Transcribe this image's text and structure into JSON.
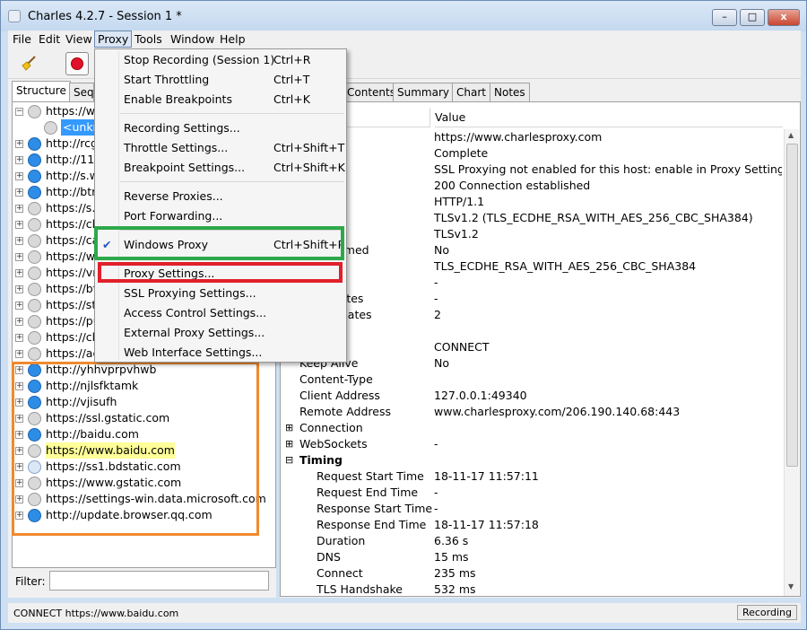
{
  "window": {
    "title": "Charles 4.2.7 - Session 1 *",
    "min": "–",
    "max": "□",
    "close": "x"
  },
  "menubar": [
    "File",
    "Edit",
    "View",
    "Proxy",
    "Tools",
    "Window",
    "Help"
  ],
  "left_tabs": [
    "Structure",
    "Sequ"
  ],
  "tree": [
    {
      "label": "https://w",
      "exp": "−",
      "icon": "lock",
      "sel": false,
      "hl": false
    },
    {
      "label": "<unkn",
      "exp": "",
      "icon": "lock",
      "sel": true,
      "hl": false
    },
    {
      "label": "http://rcg",
      "exp": "+",
      "icon": "globe",
      "sel": false,
      "hl": false
    },
    {
      "label": "http://112",
      "exp": "+",
      "icon": "globe",
      "sel": false,
      "hl": false
    },
    {
      "label": "http://s.w",
      "exp": "+",
      "icon": "globe",
      "sel": false,
      "hl": false
    },
    {
      "label": "http://btr",
      "exp": "+",
      "icon": "globe",
      "sel": false,
      "hl": false
    },
    {
      "label": "https://s.w",
      "exp": "+",
      "icon": "lock",
      "sel": false,
      "hl": false
    },
    {
      "label": "https://cli",
      "exp": "+",
      "icon": "lock",
      "sel": false,
      "hl": false
    },
    {
      "label": "https://ca",
      "exp": "+",
      "icon": "lock",
      "sel": false,
      "hl": false
    },
    {
      "label": "https://w",
      "exp": "+",
      "icon": "lock",
      "sel": false,
      "hl": false
    },
    {
      "label": "https://vn",
      "exp": "+",
      "icon": "lock",
      "sel": false,
      "hl": false
    },
    {
      "label": "https://bt",
      "exp": "+",
      "icon": "lock",
      "sel": false,
      "hl": false
    },
    {
      "label": "https://st",
      "exp": "+",
      "icon": "lock",
      "sel": false,
      "hl": false
    },
    {
      "label": "https://pu",
      "exp": "+",
      "icon": "lock",
      "sel": false,
      "hl": false
    },
    {
      "label": "https://cli",
      "exp": "+",
      "icon": "lock",
      "sel": false,
      "hl": false
    },
    {
      "label": "https://ac",
      "exp": "+",
      "icon": "lock",
      "sel": false,
      "hl": false
    },
    {
      "label": "http://yhhvprpvhwb",
      "exp": "+",
      "icon": "globe",
      "sel": false,
      "hl": false
    },
    {
      "label": "http://njlsfktamk",
      "exp": "+",
      "icon": "globe",
      "sel": false,
      "hl": false
    },
    {
      "label": "http://vjisufh",
      "exp": "+",
      "icon": "globe",
      "sel": false,
      "hl": false
    },
    {
      "label": "https://ssl.gstatic.com",
      "exp": "+",
      "icon": "lock",
      "sel": false,
      "hl": false
    },
    {
      "label": "http://baidu.com",
      "exp": "+",
      "icon": "globe",
      "sel": false,
      "hl": false
    },
    {
      "label": "https://www.baidu.com",
      "exp": "+",
      "icon": "lock",
      "sel": false,
      "hl": true
    },
    {
      "label": "https://ss1.bdstatic.com",
      "exp": "+",
      "icon": "spin",
      "sel": false,
      "hl": false
    },
    {
      "label": "https://www.gstatic.com",
      "exp": "+",
      "icon": "lock",
      "sel": false,
      "hl": false
    },
    {
      "label": "https://settings-win.data.microsoft.com",
      "exp": "+",
      "icon": "lock",
      "sel": false,
      "hl": false
    },
    {
      "label": "http://update.browser.qq.com",
      "exp": "+",
      "icon": "globe",
      "sel": false,
      "hl": false
    }
  ],
  "filter": {
    "label": "Filter:",
    "value": ""
  },
  "right_tabs": [
    "Contents",
    "Summary",
    "Chart",
    "Notes"
  ],
  "table_header": {
    "value": "Value"
  },
  "rows": [
    {
      "name": "",
      "value": "https://www.charlesproxy.com",
      "indent": 0,
      "exp": ""
    },
    {
      "name": "",
      "value": "Complete",
      "indent": 0,
      "exp": ""
    },
    {
      "name": "",
      "value": "SSL Proxying not enabled for this host: enable in Proxy Settings, ...",
      "indent": 0,
      "exp": ""
    },
    {
      "name": "e Code",
      "value": "200 Connection established",
      "indent": 0,
      "exp": ""
    },
    {
      "name": "",
      "value": "HTTP/1.1",
      "indent": 0,
      "exp": ""
    },
    {
      "name": "",
      "value": "TLSv1.2 (TLS_ECDHE_RSA_WITH_AES_256_CBC_SHA384)",
      "indent": 0,
      "exp": ""
    },
    {
      "name": "col",
      "value": "TLSv1.2",
      "indent": 0,
      "exp": ""
    },
    {
      "name": "on Resumed",
      "value": "No",
      "indent": 0,
      "exp": ""
    },
    {
      "name": "r Suite",
      "value": "TLS_ECDHE_RSA_WITH_AES_256_CBC_SHA384",
      "indent": 0,
      "exp": ""
    },
    {
      "name": "",
      "value": "-",
      "indent": 0,
      "exp": ""
    },
    {
      "name": "Certificates",
      "value": "-",
      "indent": 0,
      "exp": ""
    },
    {
      "name": "r Certificates",
      "value": "2",
      "indent": 0,
      "exp": ""
    },
    {
      "name": "sions",
      "value": "",
      "indent": 0,
      "exp": ""
    },
    {
      "name": "",
      "value": "CONNECT",
      "indent": 0,
      "exp": ""
    },
    {
      "name": "Keep Alive",
      "value": "No",
      "indent": 0,
      "exp": ""
    },
    {
      "name": "Content-Type",
      "value": "",
      "indent": 0,
      "exp": ""
    },
    {
      "name": "Client Address",
      "value": "127.0.0.1:49340",
      "indent": 0,
      "exp": ""
    },
    {
      "name": "Remote Address",
      "value": "www.charlesproxy.com/206.190.140.68:443",
      "indent": 0,
      "exp": ""
    },
    {
      "name": "Connection",
      "value": "",
      "indent": 0,
      "exp": "+"
    },
    {
      "name": "WebSockets",
      "value": "-",
      "indent": 0,
      "exp": "+"
    },
    {
      "name": "Timing",
      "value": "",
      "indent": 0,
      "exp": "−",
      "bold": true
    },
    {
      "name": "Request Start Time",
      "value": "18-11-17 11:57:11",
      "indent": 1,
      "exp": ""
    },
    {
      "name": "Request End Time",
      "value": "-",
      "indent": 1,
      "exp": ""
    },
    {
      "name": "Response Start Time",
      "value": "-",
      "indent": 1,
      "exp": ""
    },
    {
      "name": "Response End Time",
      "value": "18-11-17 11:57:18",
      "indent": 1,
      "exp": ""
    },
    {
      "name": "Duration",
      "value": "6.36 s",
      "indent": 1,
      "exp": ""
    },
    {
      "name": "DNS",
      "value": "15 ms",
      "indent": 1,
      "exp": ""
    },
    {
      "name": "Connect",
      "value": "235 ms",
      "indent": 1,
      "exp": ""
    },
    {
      "name": "TLS Handshake",
      "value": "532 ms",
      "indent": 1,
      "exp": ""
    }
  ],
  "status": {
    "text": "CONNECT https://www.baidu.com",
    "recording": "Recording"
  },
  "proxy_menu": [
    {
      "label": "Stop Recording (Session 1)",
      "shortcut": "Ctrl+R"
    },
    {
      "label": "Start Throttling",
      "shortcut": "Ctrl+T"
    },
    {
      "label": "Enable Breakpoints",
      "shortcut": "Ctrl+K"
    },
    {
      "sep": true
    },
    {
      "label": "Recording Settings...",
      "shortcut": ""
    },
    {
      "label": "Throttle Settings...",
      "shortcut": "Ctrl+Shift+T"
    },
    {
      "label": "Breakpoint Settings...",
      "shortcut": "Ctrl+Shift+K"
    },
    {
      "sep": true
    },
    {
      "label": "Reverse Proxies...",
      "shortcut": ""
    },
    {
      "label": "Port Forwarding...",
      "shortcut": ""
    },
    {
      "sep": true
    },
    {
      "label": "Windows Proxy",
      "shortcut": "Ctrl+Shift+P",
      "checked": true
    },
    {
      "sep": true
    },
    {
      "label": "Proxy Settings...",
      "shortcut": ""
    },
    {
      "label": "SSL Proxying Settings...",
      "shortcut": ""
    },
    {
      "label": "Access Control Settings...",
      "shortcut": ""
    },
    {
      "label": "External Proxy Settings...",
      "shortcut": ""
    },
    {
      "label": "Web Interface Settings...",
      "shortcut": ""
    }
  ],
  "colors": {
    "green_highlight": "#2ea84a",
    "red_highlight": "#e0202a",
    "orange_highlight": "#f08a2c",
    "selection": "#3399ff",
    "record": "#e0122b"
  }
}
